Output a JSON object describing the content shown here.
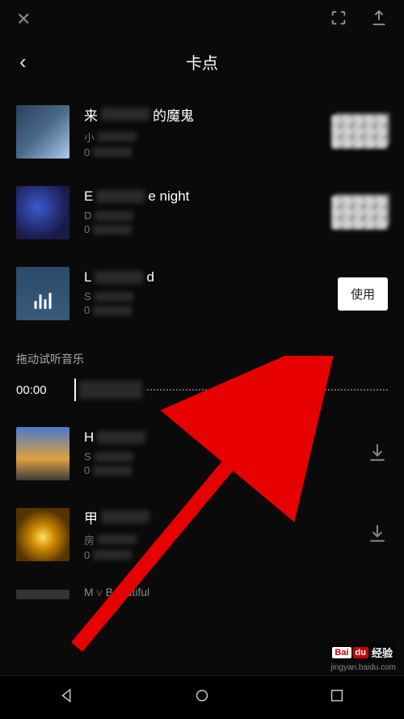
{
  "topbar": {
    "close": "✕"
  },
  "header": {
    "back": "‹",
    "title": "卡点"
  },
  "tracks": [
    {
      "title_pre": "来",
      "title_post": "的魔鬼",
      "meta1": "小",
      "meta2": "0"
    },
    {
      "title_pre": "E",
      "title_post": "e night",
      "meta1": "D",
      "meta2": "0"
    },
    {
      "title_pre": "L",
      "title_post": "d",
      "meta1": "S",
      "meta2": "0",
      "selected": true
    },
    {
      "title_pre": "H",
      "title_post": "",
      "meta1": "S",
      "meta2": "0"
    },
    {
      "title_pre": "甲",
      "title_post": "",
      "meta1": "房",
      "meta2": "0"
    },
    {
      "title_pre": "M",
      "title_post": "Beautiful",
      "meta1": "",
      "meta2": ""
    }
  ],
  "use_label": "使用",
  "scrub": {
    "label": "拖动试听音乐",
    "time": "00:00"
  },
  "watermark": {
    "brand1": "Bai",
    "brand2": "du",
    "text": "经验",
    "url": "jingyan.baidu.com"
  }
}
